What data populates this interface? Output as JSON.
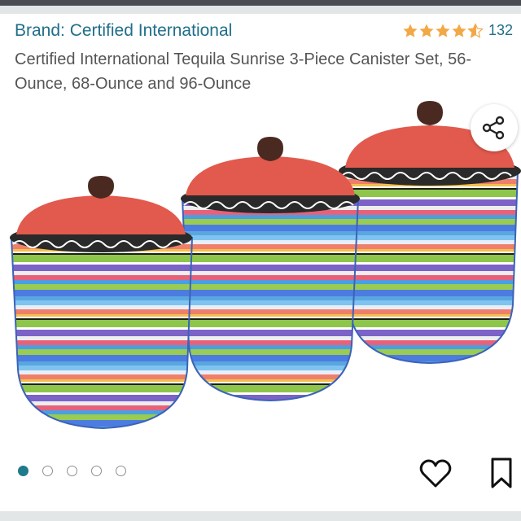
{
  "header": {
    "brand_link": "Brand: Certified International",
    "rating_stars": 4.5,
    "review_count": "132"
  },
  "product": {
    "title": "Certified International Tequila Sunrise 3-Piece Canister Set, 56-Ounce, 68-Ounce and 96-Ounce"
  },
  "gallery": {
    "image_count": 5,
    "active_index": 0,
    "share_icon": "share-icon",
    "wishlist_icon": "heart-outline-icon",
    "save_icon": "bookmark-outline-icon"
  },
  "colors": {
    "link": "#1f6e8a",
    "star": "#f3a847",
    "active_dot": "#1f7a8c",
    "lid_red": "#e15a4d"
  }
}
